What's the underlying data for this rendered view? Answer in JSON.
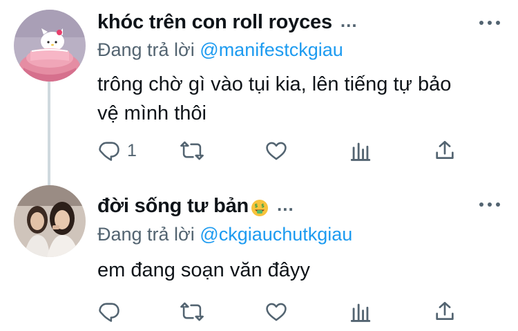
{
  "reply_prefix": "Đang trả lời",
  "colors": {
    "link": "#1d9bf0",
    "secondary": "#536471",
    "text": "#0f1419",
    "thread_line": "#cfd9de"
  },
  "tweets": [
    {
      "display_name": "khóc trên con roll royces",
      "name_suffix": "...",
      "reply_handle": "@manifestckgiau",
      "text": "trông chờ gì vào tụi kia, lên tiếng tự bảo vệ mình thôi",
      "reply_count": "1",
      "avatar": "hello-kitty-in-pink-bed-avatar"
    },
    {
      "display_name": "đời sống tư bản",
      "name_emoji": "money-mouth-face-emoji",
      "name_suffix": "...",
      "reply_handle": "@ckgiauchutkgiau",
      "text": "em đang soạn văn đâyy",
      "reply_count": "",
      "avatar": "two-women-photo-avatar"
    }
  ]
}
